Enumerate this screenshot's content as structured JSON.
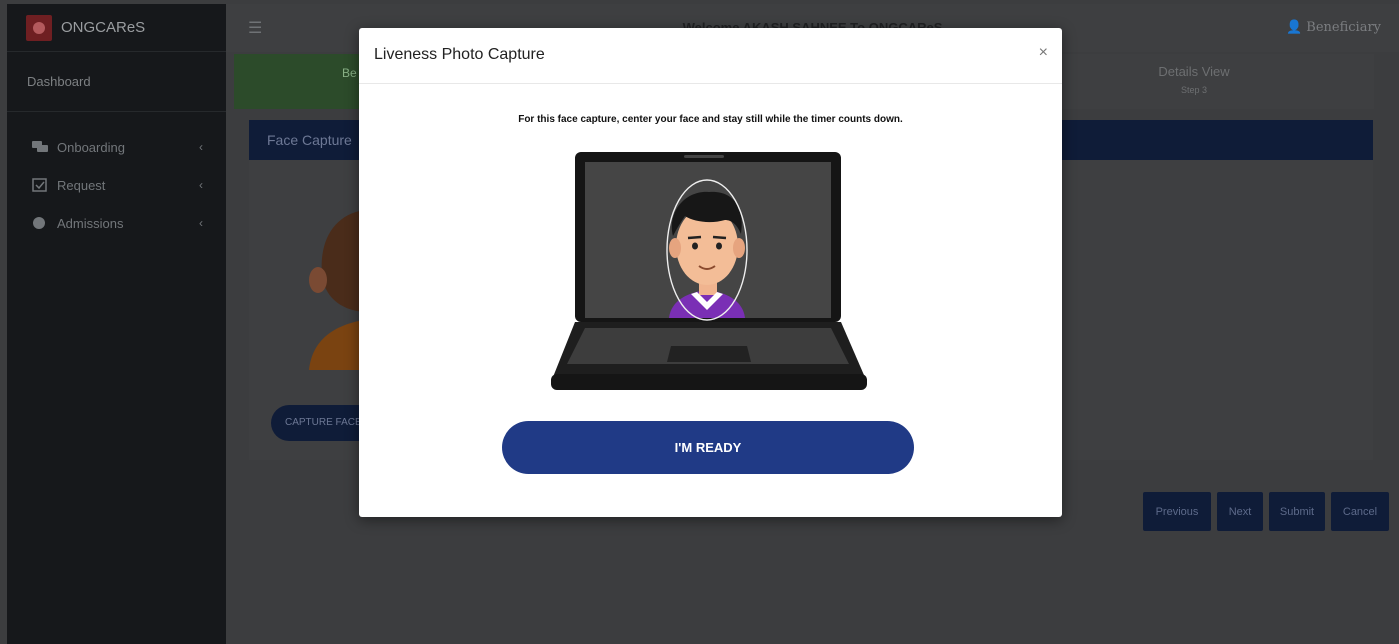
{
  "app": {
    "brand": "ONGCAReS",
    "welcome": "Welcome AKASH SAHNEE To ONGCAReS",
    "user_role": "Beneficiary"
  },
  "sidebar": {
    "dashboard": "Dashboard",
    "items": [
      {
        "label": "Onboarding",
        "icon": "chat-icon"
      },
      {
        "label": "Request",
        "icon": "calendar-check-icon"
      },
      {
        "label": "Admissions",
        "icon": "circle-icon"
      }
    ]
  },
  "steps": {
    "active_label": "Be",
    "step3_label": "Details View",
    "step3_sub": "Step 3"
  },
  "card": {
    "title": "Face Capture",
    "capture_button": "CAPTURE FACE"
  },
  "wizard": {
    "previous": "Previous",
    "next": "Next",
    "submit": "Submit",
    "cancel": "Cancel"
  },
  "modal": {
    "title": "Liveness Photo Capture",
    "close": "×",
    "instruction": "For this face capture, center your face and stay still while the timer counts down.",
    "button": "I'M READY"
  },
  "colors": {
    "primary": "#203a86",
    "sidebar": "#16181b",
    "header_bar": "#0f1c38",
    "active_step": "#2c4b2a"
  }
}
